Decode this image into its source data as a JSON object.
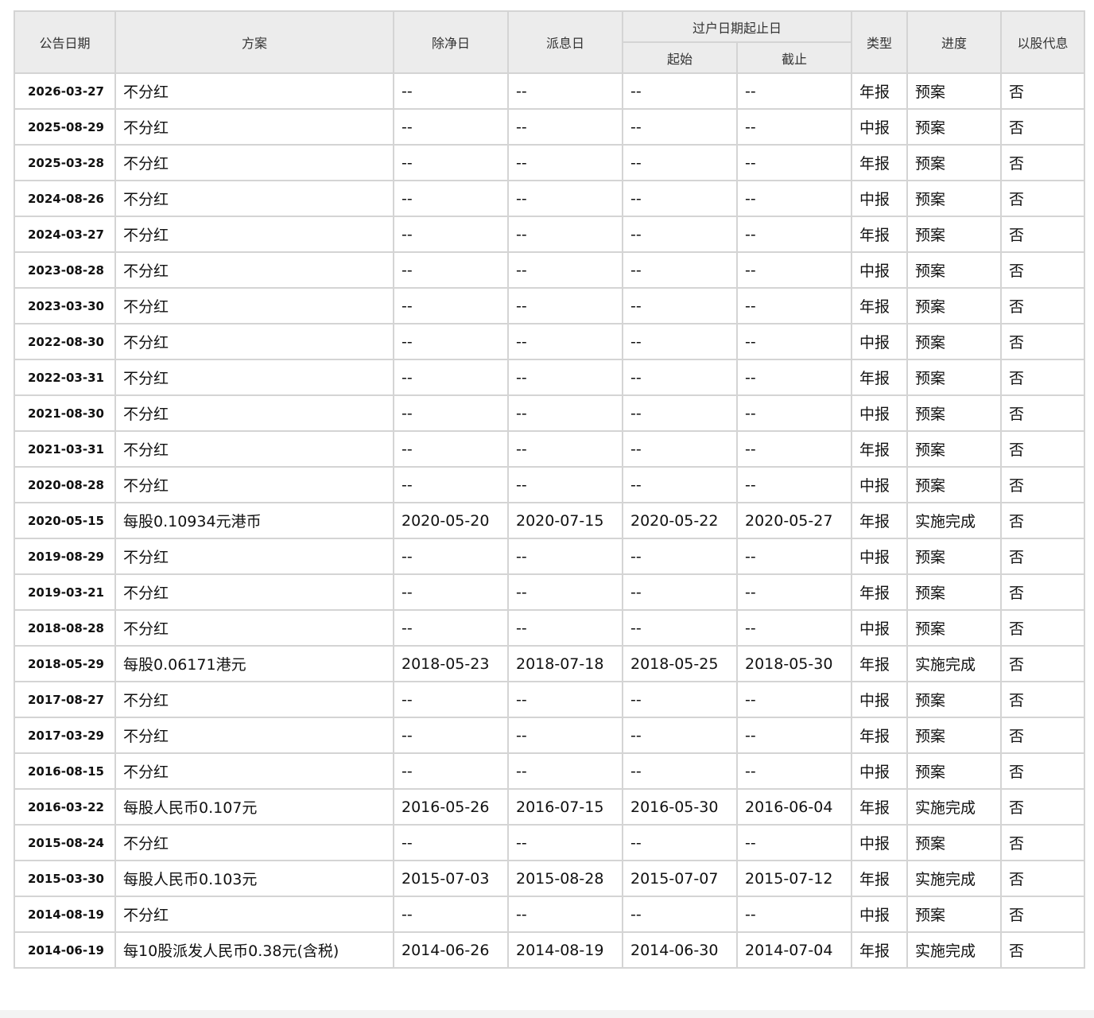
{
  "headers": {
    "date": "公告日期",
    "plan": "方案",
    "ex_date": "除净日",
    "pay_date": "派息日",
    "transfer_group": "过户日期起止日",
    "transfer_start": "起始",
    "transfer_end": "截止",
    "type": "类型",
    "progress": "进度",
    "scrip": "以股代息"
  },
  "rows": [
    {
      "date": "2026-03-27",
      "plan": "不分红",
      "ex": "--",
      "pay": "--",
      "start": "--",
      "end": "--",
      "type": "年报",
      "progress": "预案",
      "scrip": "否"
    },
    {
      "date": "2025-08-29",
      "plan": "不分红",
      "ex": "--",
      "pay": "--",
      "start": "--",
      "end": "--",
      "type": "中报",
      "progress": "预案",
      "scrip": "否"
    },
    {
      "date": "2025-03-28",
      "plan": "不分红",
      "ex": "--",
      "pay": "--",
      "start": "--",
      "end": "--",
      "type": "年报",
      "progress": "预案",
      "scrip": "否"
    },
    {
      "date": "2024-08-26",
      "plan": "不分红",
      "ex": "--",
      "pay": "--",
      "start": "--",
      "end": "--",
      "type": "中报",
      "progress": "预案",
      "scrip": "否"
    },
    {
      "date": "2024-03-27",
      "plan": "不分红",
      "ex": "--",
      "pay": "--",
      "start": "--",
      "end": "--",
      "type": "年报",
      "progress": "预案",
      "scrip": "否"
    },
    {
      "date": "2023-08-28",
      "plan": "不分红",
      "ex": "--",
      "pay": "--",
      "start": "--",
      "end": "--",
      "type": "中报",
      "progress": "预案",
      "scrip": "否"
    },
    {
      "date": "2023-03-30",
      "plan": "不分红",
      "ex": "--",
      "pay": "--",
      "start": "--",
      "end": "--",
      "type": "年报",
      "progress": "预案",
      "scrip": "否"
    },
    {
      "date": "2022-08-30",
      "plan": "不分红",
      "ex": "--",
      "pay": "--",
      "start": "--",
      "end": "--",
      "type": "中报",
      "progress": "预案",
      "scrip": "否"
    },
    {
      "date": "2022-03-31",
      "plan": "不分红",
      "ex": "--",
      "pay": "--",
      "start": "--",
      "end": "--",
      "type": "年报",
      "progress": "预案",
      "scrip": "否"
    },
    {
      "date": "2021-08-30",
      "plan": "不分红",
      "ex": "--",
      "pay": "--",
      "start": "--",
      "end": "--",
      "type": "中报",
      "progress": "预案",
      "scrip": "否"
    },
    {
      "date": "2021-03-31",
      "plan": "不分红",
      "ex": "--",
      "pay": "--",
      "start": "--",
      "end": "--",
      "type": "年报",
      "progress": "预案",
      "scrip": "否"
    },
    {
      "date": "2020-08-28",
      "plan": "不分红",
      "ex": "--",
      "pay": "--",
      "start": "--",
      "end": "--",
      "type": "中报",
      "progress": "预案",
      "scrip": "否"
    },
    {
      "date": "2020-05-15",
      "plan": "每股0.10934元港币",
      "ex": "2020-05-20",
      "pay": "2020-07-15",
      "start": "2020-05-22",
      "end": "2020-05-27",
      "type": "年报",
      "progress": "实施完成",
      "scrip": "否"
    },
    {
      "date": "2019-08-29",
      "plan": "不分红",
      "ex": "--",
      "pay": "--",
      "start": "--",
      "end": "--",
      "type": "中报",
      "progress": "预案",
      "scrip": "否"
    },
    {
      "date": "2019-03-21",
      "plan": "不分红",
      "ex": "--",
      "pay": "--",
      "start": "--",
      "end": "--",
      "type": "年报",
      "progress": "预案",
      "scrip": "否"
    },
    {
      "date": "2018-08-28",
      "plan": "不分红",
      "ex": "--",
      "pay": "--",
      "start": "--",
      "end": "--",
      "type": "中报",
      "progress": "预案",
      "scrip": "否"
    },
    {
      "date": "2018-05-29",
      "plan": "每股0.06171港元",
      "ex": "2018-05-23",
      "pay": "2018-07-18",
      "start": "2018-05-25",
      "end": "2018-05-30",
      "type": "年报",
      "progress": "实施完成",
      "scrip": "否"
    },
    {
      "date": "2017-08-27",
      "plan": "不分红",
      "ex": "--",
      "pay": "--",
      "start": "--",
      "end": "--",
      "type": "中报",
      "progress": "预案",
      "scrip": "否"
    },
    {
      "date": "2017-03-29",
      "plan": "不分红",
      "ex": "--",
      "pay": "--",
      "start": "--",
      "end": "--",
      "type": "年报",
      "progress": "预案",
      "scrip": "否"
    },
    {
      "date": "2016-08-15",
      "plan": "不分红",
      "ex": "--",
      "pay": "--",
      "start": "--",
      "end": "--",
      "type": "中报",
      "progress": "预案",
      "scrip": "否"
    },
    {
      "date": "2016-03-22",
      "plan": "每股人民币0.107元",
      "ex": "2016-05-26",
      "pay": "2016-07-15",
      "start": "2016-05-30",
      "end": "2016-06-04",
      "type": "年报",
      "progress": "实施完成",
      "scrip": "否"
    },
    {
      "date": "2015-08-24",
      "plan": "不分红",
      "ex": "--",
      "pay": "--",
      "start": "--",
      "end": "--",
      "type": "中报",
      "progress": "预案",
      "scrip": "否"
    },
    {
      "date": "2015-03-30",
      "plan": "每股人民币0.103元",
      "ex": "2015-07-03",
      "pay": "2015-08-28",
      "start": "2015-07-07",
      "end": "2015-07-12",
      "type": "年报",
      "progress": "实施完成",
      "scrip": "否"
    },
    {
      "date": "2014-08-19",
      "plan": "不分红",
      "ex": "--",
      "pay": "--",
      "start": "--",
      "end": "--",
      "type": "中报",
      "progress": "预案",
      "scrip": "否"
    },
    {
      "date": "2014-06-19",
      "plan": "每10股派发人民币0.38元(含税)",
      "ex": "2014-06-26",
      "pay": "2014-08-19",
      "start": "2014-06-30",
      "end": "2014-07-04",
      "type": "年报",
      "progress": "实施完成",
      "scrip": "否"
    }
  ]
}
